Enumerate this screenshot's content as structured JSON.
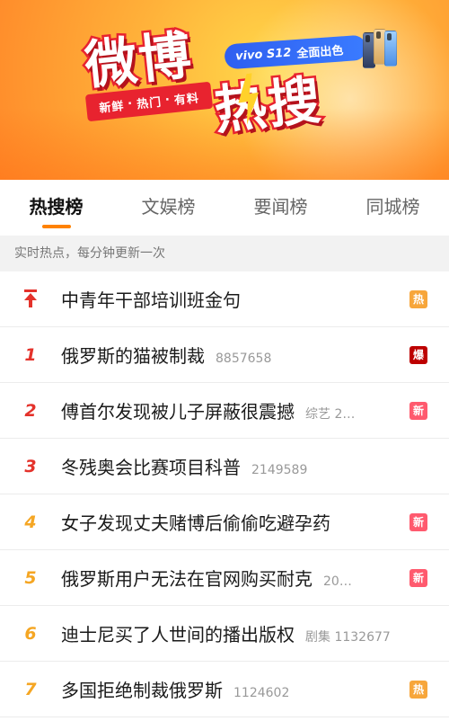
{
  "banner": {
    "logo_line1": "微博",
    "logo_line2": "热搜",
    "slogan": [
      "新鲜",
      "热门",
      "有料"
    ],
    "ad_brand": "vivo S12",
    "ad_text": "全面出色"
  },
  "tabs": [
    {
      "label": "热搜榜",
      "active": true
    },
    {
      "label": "文娱榜",
      "active": false
    },
    {
      "label": "要闻榜",
      "active": false
    },
    {
      "label": "同城榜",
      "active": false
    }
  ],
  "notice": "实时热点，每分钟更新一次",
  "items": [
    {
      "rank": "",
      "pinned": true,
      "title": "中青年干部培训班金句",
      "meta": "",
      "badge": "热",
      "badge_type": "hot"
    },
    {
      "rank": "1",
      "pinned": false,
      "title": "俄罗斯的猫被制裁",
      "meta": "8857658",
      "badge": "爆",
      "badge_type": "boom"
    },
    {
      "rank": "2",
      "pinned": false,
      "title": "傅首尔发现被儿子屏蔽很震撼",
      "meta": "综艺 2…",
      "badge": "新",
      "badge_type": "new"
    },
    {
      "rank": "3",
      "pinned": false,
      "title": "冬残奥会比赛项目科普",
      "meta": "2149589",
      "badge": "",
      "badge_type": ""
    },
    {
      "rank": "4",
      "pinned": false,
      "title": "女子发现丈夫赌博后偷偷吃避孕药",
      "meta": "",
      "badge": "新",
      "badge_type": "new"
    },
    {
      "rank": "5",
      "pinned": false,
      "title": "俄罗斯用户无法在官网购买耐克",
      "meta": "20…",
      "badge": "新",
      "badge_type": "new"
    },
    {
      "rank": "6",
      "pinned": false,
      "title": "迪士尼买了人世间的播出版权",
      "meta": "剧集 1132677",
      "badge": "",
      "badge_type": ""
    },
    {
      "rank": "7",
      "pinned": false,
      "title": "多国拒绝制裁俄罗斯",
      "meta": "1124602",
      "badge": "热",
      "badge_type": "hot"
    }
  ],
  "colors": {
    "accent": "#ff8200",
    "rank_top": "#e4322b",
    "rank_normal": "#f5a623",
    "badge_hot": "#f7a63b",
    "badge_new": "#ff5a6e",
    "badge_boom": "#bd0000"
  }
}
